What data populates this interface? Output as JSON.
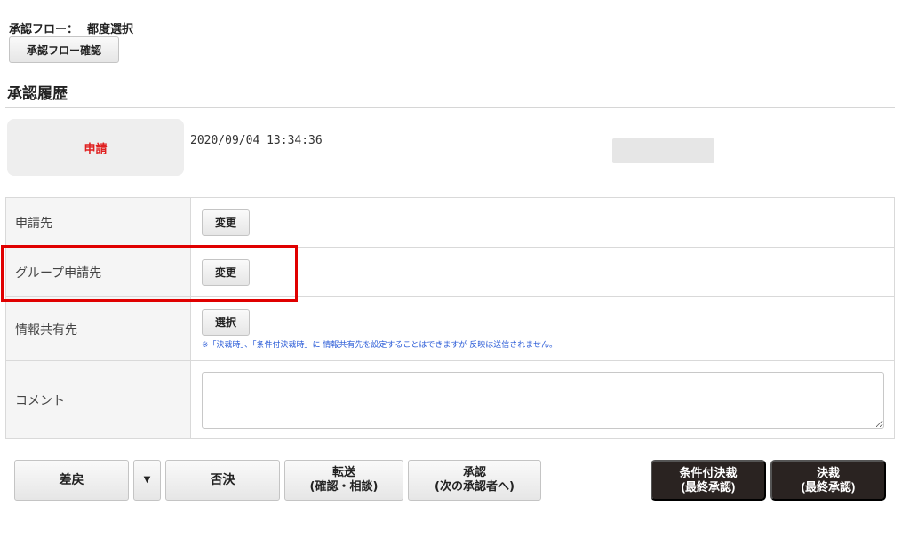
{
  "flow": {
    "label": "承認フロー：",
    "value": "都度選択",
    "confirm_button": "承認フロー確認"
  },
  "history": {
    "title": "承認履歴",
    "status": "申請",
    "datetime": "2020/09/04 13:34:36"
  },
  "form": {
    "rows": [
      {
        "label": "申請先",
        "button": "変更"
      },
      {
        "label": "グループ申請先",
        "button": "変更"
      },
      {
        "label": "情報共有先",
        "button": "選択",
        "note": "※「決裁時」、「条件付決裁時」に 情報共有先を設定することはできますが 反映は送信されません。"
      },
      {
        "label": "コメント"
      }
    ]
  },
  "actions": {
    "return": "差戻",
    "dropdown_icon": "▼",
    "reject": "否決",
    "forward": "転送\n(確認・相談)",
    "approve": "承認\n(次の承認者へ)",
    "conditional_final": "条件付決裁\n(最終承認)",
    "final": "決裁\n(最終承認)"
  },
  "colors": {
    "status_red": "#e02020",
    "highlight_red": "#e00000",
    "dark_button": "#2a2321",
    "note_blue": "#2a5bd7"
  }
}
